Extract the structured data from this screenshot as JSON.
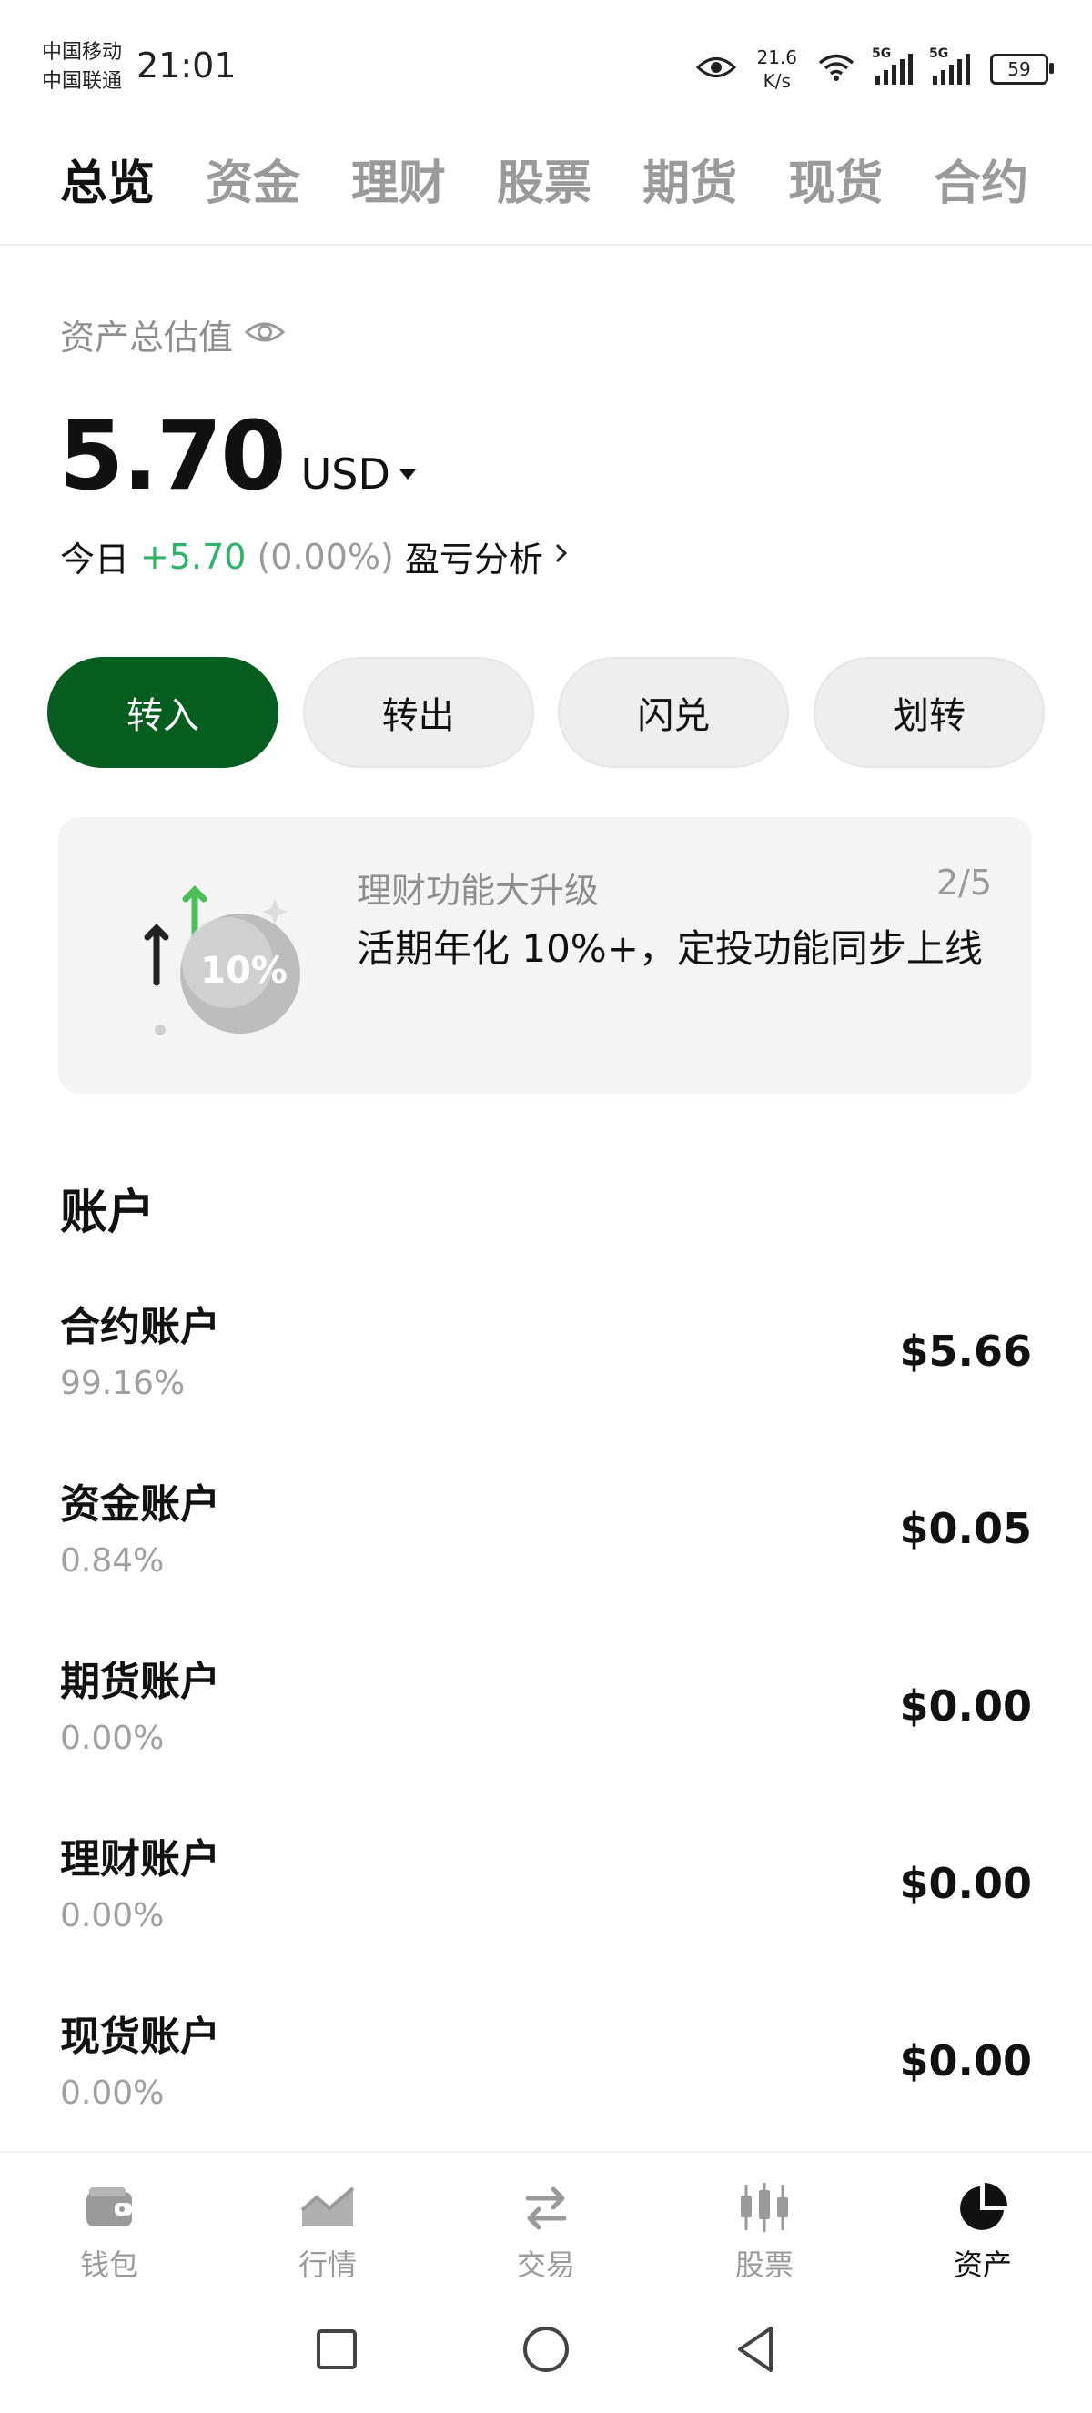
{
  "status_bar": {
    "carrier1": "中国移动",
    "carrier2": "中国联通",
    "time": "21:01",
    "net_speed_value": "21.6",
    "net_speed_unit": "K/s",
    "sim1_label": "5G",
    "sim2_label": "5G",
    "battery": "59"
  },
  "tabs": [
    {
      "label": "总览",
      "active": true
    },
    {
      "label": "资金"
    },
    {
      "label": "理财"
    },
    {
      "label": "股票"
    },
    {
      "label": "期货"
    },
    {
      "label": "现货"
    },
    {
      "label": "合约"
    }
  ],
  "overview": {
    "total_label": "资产总估值",
    "total_value": "5.70",
    "currency": "USD",
    "today_label": "今日",
    "today_change": "+5.70",
    "today_pct": "(0.00%)",
    "pnl_link": "盈亏分析"
  },
  "actions": {
    "deposit": "转入",
    "withdraw": "转出",
    "convert": "闪兑",
    "transfer": "划转"
  },
  "banner": {
    "title": "理财功能大升级",
    "page": "2/5",
    "text": "活期年化 10%+，定投功能同步上线",
    "badge": "10%"
  },
  "accounts": {
    "title": "账户",
    "rows": [
      {
        "name": "合约账户",
        "pct": "99.16%",
        "value": "$5.66"
      },
      {
        "name": "资金账户",
        "pct": "0.84%",
        "value": "$0.05"
      },
      {
        "name": "期货账户",
        "pct": "0.00%",
        "value": "$0.00"
      },
      {
        "name": "理财账户",
        "pct": "0.00%",
        "value": "$0.00"
      },
      {
        "name": "现货账户",
        "pct": "0.00%",
        "value": "$0.00"
      }
    ]
  },
  "bottom_nav": {
    "wallet": "钱包",
    "markets": "行情",
    "trade": "交易",
    "stocks": "股票",
    "assets": "资产"
  },
  "colors": {
    "primary": "#055d1f",
    "positive": "#2fb36b",
    "muted": "#9a9a9a"
  }
}
